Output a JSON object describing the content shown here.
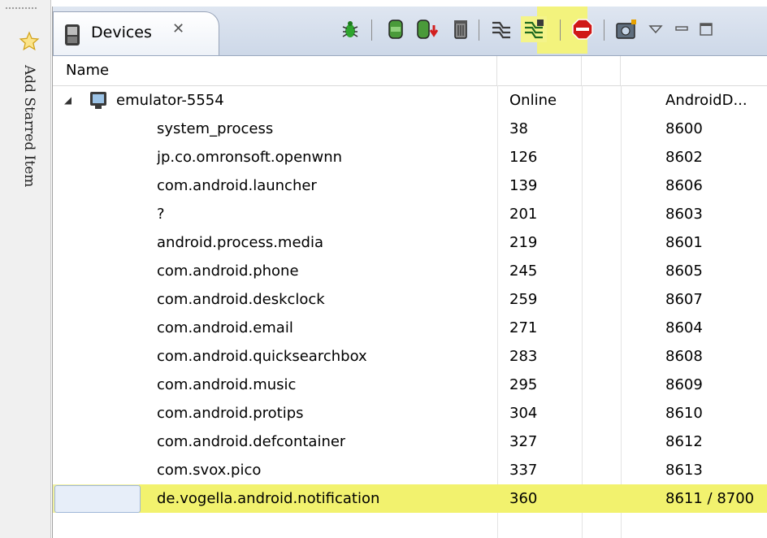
{
  "sidebar": {
    "starred_label": "Add Starred Item"
  },
  "view": {
    "tab_title": "Devices",
    "tab_close": "✕",
    "toolbar_icons": [
      "debug-bug-icon",
      "update-heap-icon",
      "dump-hprof-icon",
      "cause-gc-icon",
      "update-threads-icon",
      "start-method-profiling-icon",
      "stop-process-icon",
      "screen-capture-icon",
      "view-menu-icon",
      "minimize-icon",
      "maximize-icon"
    ]
  },
  "table": {
    "columns": [
      "Name",
      "",
      "",
      ""
    ],
    "device": {
      "name": "emulator-5554",
      "status": "Online",
      "port": "AndroidD..."
    },
    "rows": [
      {
        "name": "system_process",
        "pid": "38",
        "port": "8600"
      },
      {
        "name": "jp.co.omronsoft.openwnn",
        "pid": "126",
        "port": "8602"
      },
      {
        "name": "com.android.launcher",
        "pid": "139",
        "port": "8606"
      },
      {
        "name": "?",
        "pid": "201",
        "port": "8603"
      },
      {
        "name": "android.process.media",
        "pid": "219",
        "port": "8601"
      },
      {
        "name": "com.android.phone",
        "pid": "245",
        "port": "8605"
      },
      {
        "name": "com.android.deskclock",
        "pid": "259",
        "port": "8607"
      },
      {
        "name": "com.android.email",
        "pid": "271",
        "port": "8604"
      },
      {
        "name": "com.android.quicksearchbox",
        "pid": "283",
        "port": "8608"
      },
      {
        "name": "com.android.music",
        "pid": "295",
        "port": "8609"
      },
      {
        "name": "com.android.protips",
        "pid": "304",
        "port": "8610"
      },
      {
        "name": "com.android.defcontainer",
        "pid": "327",
        "port": "8612"
      },
      {
        "name": "com.svox.pico",
        "pid": "337",
        "port": "8613"
      },
      {
        "name": "de.vogella.android.notification",
        "pid": "360",
        "port": "8611 / 8700"
      }
    ],
    "selected_index": 13
  },
  "colors": {
    "highlight": "#f2f26e",
    "tab_bg": "#dfe6f1"
  }
}
